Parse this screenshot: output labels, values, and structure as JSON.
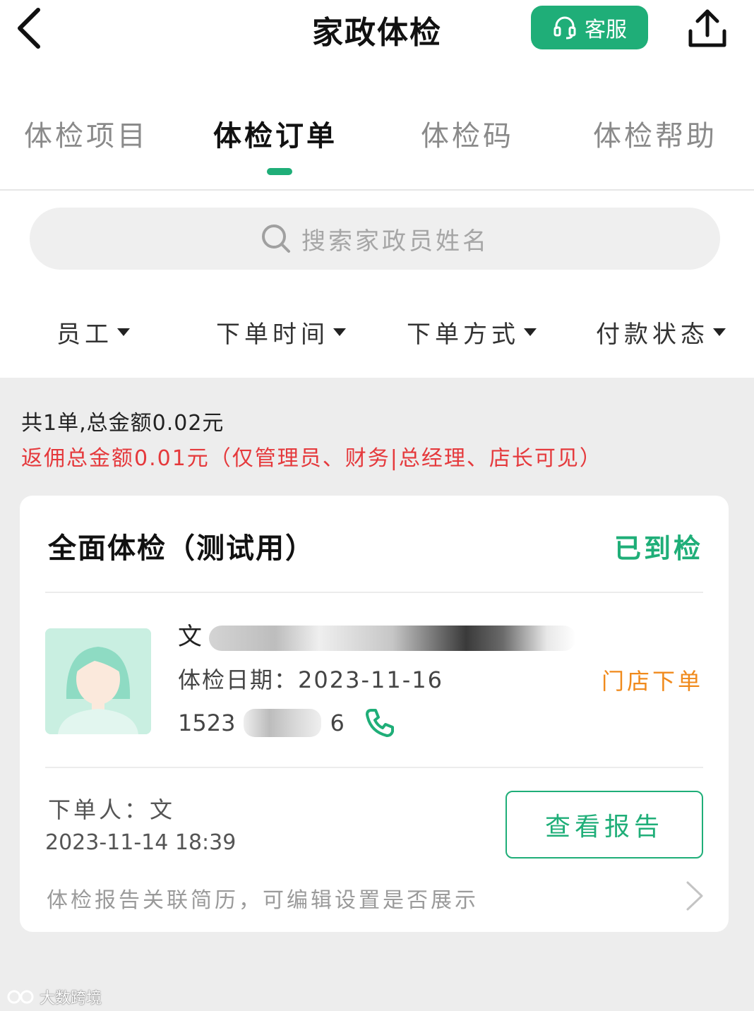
{
  "navbar": {
    "title": "家政体检",
    "service_label": "客服",
    "back_icon": "chevron-left-icon",
    "share_icon": "share-upload-icon"
  },
  "tabs": [
    {
      "label": "体检项目",
      "active": false
    },
    {
      "label": "体检订单",
      "active": true
    },
    {
      "label": "体检码",
      "active": false
    },
    {
      "label": "体检帮助",
      "active": false
    }
  ],
  "search": {
    "placeholder": "搜索家政员姓名"
  },
  "filters": [
    {
      "label": "员工"
    },
    {
      "label": "下单时间"
    },
    {
      "label": "下单方式"
    },
    {
      "label": "付款状态"
    }
  ],
  "summary": {
    "totals": "共1单,总金额0.02元",
    "commission": "返佣总金额0.01元（仅管理员、财务|总经理、店长可见）"
  },
  "order": {
    "title": "全面体检（测试用）",
    "status": "已到检",
    "employee_name_initial": "文",
    "exam_date": "体检日期：2023-11-16",
    "order_source": "门店下单",
    "phone_prefix": "1523",
    "phone_suffix": "6",
    "orderer": "下单人：文",
    "order_time": "2023-11-14  18:39",
    "report_button": "查看报告",
    "resume_note": "体检报告关联简历，可编辑设置是否展示"
  },
  "watermark": {
    "text": "大数跨境"
  },
  "colors": {
    "accent": "#1fae78",
    "commission": "#e5393c",
    "source": "#f08a1c"
  }
}
